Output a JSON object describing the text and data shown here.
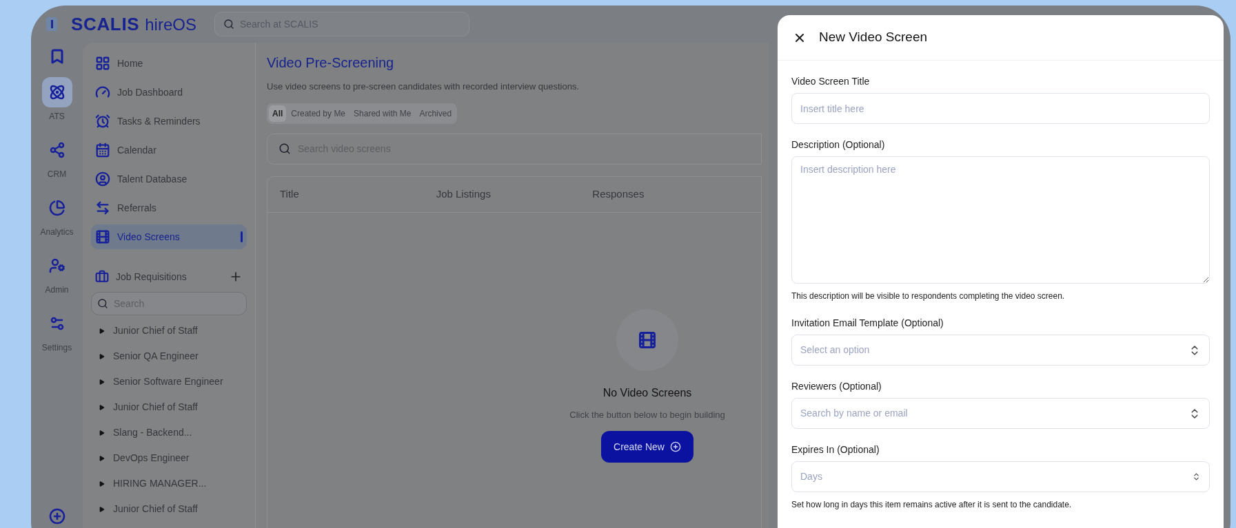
{
  "header": {
    "logo": "SCALIS",
    "product": "hireOS",
    "search": {
      "placeholder": "Search at SCALIS"
    }
  },
  "rail": [
    {
      "label": "ATS",
      "selected": true
    },
    {
      "label": "CRM",
      "selected": false
    },
    {
      "label": "Analytics",
      "selected": false
    },
    {
      "label": "Admin",
      "selected": false
    },
    {
      "label": "Settings",
      "selected": false
    }
  ],
  "nav": [
    {
      "label": "Home",
      "selected": false
    },
    {
      "label": "Job Dashboard",
      "selected": false
    },
    {
      "label": "Tasks & Reminders",
      "selected": false
    },
    {
      "label": "Calendar",
      "selected": false
    },
    {
      "label": "Talent Database",
      "selected": false
    },
    {
      "label": "Referrals",
      "selected": false
    },
    {
      "label": "Video Screens",
      "selected": true
    }
  ],
  "job_requisitions": {
    "title": "Job Requisitions",
    "search": {
      "placeholder": "Search"
    },
    "items": [
      {
        "label": "Junior Chief of Staff",
        "expanded": false
      },
      {
        "label": "Senior QA Engineer",
        "expanded": false
      },
      {
        "label": "Senior Software Engineer",
        "expanded": false
      },
      {
        "label": "Junior Chief of Staff",
        "expanded": false
      },
      {
        "label": "Slang - Backend...",
        "expanded": false
      },
      {
        "label": "DevOps Engineer",
        "expanded": false
      },
      {
        "label": "HIRING MANAGER...",
        "expanded": false
      },
      {
        "label": "Junior Chief of Staff",
        "expanded": false
      }
    ]
  },
  "main": {
    "title": "Video Pre-Screening",
    "description": "Use video screens to pre-screen candidates with recorded interview questions.",
    "filters": [
      {
        "label": "All",
        "selected": true
      },
      {
        "label": "Created by Me",
        "selected": false
      },
      {
        "label": "Shared with Me",
        "selected": false
      },
      {
        "label": "Archived",
        "selected": false
      }
    ],
    "search": {
      "placeholder": "Search video screens"
    },
    "table": {
      "columns": [
        "Title",
        "Job Listings",
        "Responses"
      ]
    },
    "empty_state": {
      "title": "No Video Screens",
      "message": "Click the button below to begin building",
      "button": "Create New"
    }
  },
  "drawer": {
    "title": "New Video Screen",
    "fields": [
      {
        "kind": "text",
        "label": "Video Screen Title",
        "placeholder": "Insert title here"
      },
      {
        "kind": "textarea",
        "label": "Description (Optional)",
        "placeholder": "Insert description here",
        "help": "This description will be visible to respondents completing the video screen."
      },
      {
        "kind": "select",
        "label": "Invitation Email Template (Optional)",
        "placeholder": "Select an option"
      },
      {
        "kind": "select",
        "label": "Reviewers (Optional)",
        "placeholder": "Search by name or email"
      },
      {
        "kind": "number",
        "label": "Expires In (Optional)",
        "placeholder": "Days",
        "help": "Set how long in days this item remains active after it is sent to the candidate."
      }
    ]
  }
}
